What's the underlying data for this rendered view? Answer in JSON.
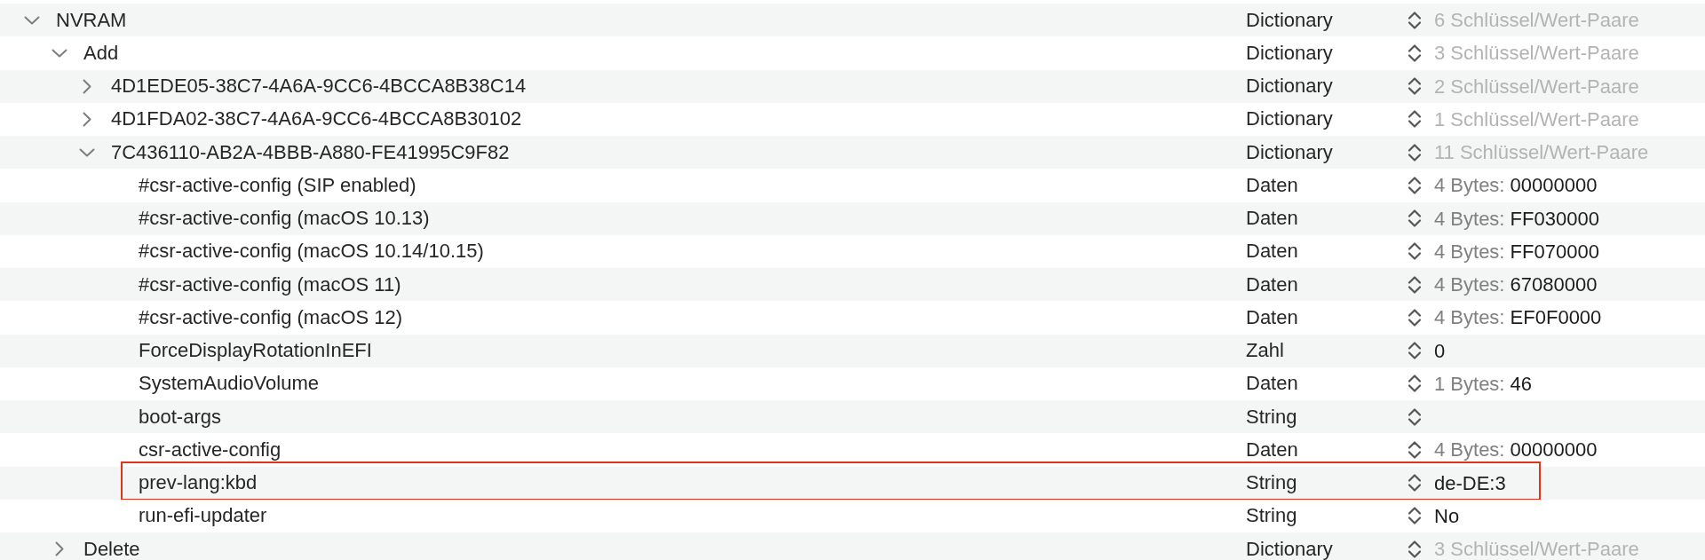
{
  "tree": [
    {
      "key": "NVRAM",
      "type": "Dictionary",
      "kind": "dictionary",
      "summary": "6 Schlüssel/Wert-Paare",
      "expanded": true,
      "children": [
        {
          "key": "Add",
          "type": "Dictionary",
          "kind": "dictionary",
          "summary": "3 Schlüssel/Wert-Paare",
          "expanded": true,
          "children": [
            {
              "key": "4D1EDE05-38C7-4A6A-9CC6-4BCCA8B38C14",
              "type": "Dictionary",
              "kind": "dictionary",
              "summary": "2 Schlüssel/Wert-Paare",
              "expanded": false
            },
            {
              "key": "4D1FDA02-38C7-4A6A-9CC6-4BCCA8B30102",
              "type": "Dictionary",
              "kind": "dictionary",
              "summary": "1 Schlüssel/Wert-Paare",
              "expanded": false
            },
            {
              "key": "7C436110-AB2A-4BBB-A880-FE41995C9F82",
              "type": "Dictionary",
              "kind": "dictionary",
              "summary": "11 Schlüssel/Wert-Paare",
              "expanded": true,
              "children": [
                {
                  "key": "#csr-active-config (SIP enabled)",
                  "type": "Daten",
                  "kind": "data",
                  "size": "4 Bytes:",
                  "value": "00000000",
                  "highlighted": false
                },
                {
                  "key": "#csr-active-config (macOS 10.13)",
                  "type": "Daten",
                  "kind": "data",
                  "size": "4 Bytes:",
                  "value": "FF030000",
                  "highlighted": false
                },
                {
                  "key": "#csr-active-config (macOS 10.14/10.15)",
                  "type": "Daten",
                  "kind": "data",
                  "size": "4 Bytes:",
                  "value": "FF070000",
                  "highlighted": false
                },
                {
                  "key": "#csr-active-config (macOS 11)",
                  "type": "Daten",
                  "kind": "data",
                  "size": "4 Bytes:",
                  "value": "67080000",
                  "highlighted": false
                },
                {
                  "key": "#csr-active-config (macOS 12)",
                  "type": "Daten",
                  "kind": "data",
                  "size": "4 Bytes:",
                  "value": "EF0F0000",
                  "highlighted": false
                },
                {
                  "key": "ForceDisplayRotationInEFI",
                  "type": "Zahl",
                  "kind": "number",
                  "value": "0",
                  "highlighted": false
                },
                {
                  "key": "SystemAudioVolume",
                  "type": "Daten",
                  "kind": "data",
                  "size": "1 Bytes:",
                  "value": "46",
                  "highlighted": false
                },
                {
                  "key": "boot-args",
                  "type": "String",
                  "kind": "string",
                  "highlighted": false
                },
                {
                  "key": "csr-active-config",
                  "type": "Daten",
                  "kind": "data",
                  "size": "4 Bytes:",
                  "value": "00000000",
                  "highlighted": false
                },
                {
                  "key": "prev-lang:kbd",
                  "type": "String",
                  "kind": "string",
                  "value": "de-DE:3",
                  "highlighted": true
                },
                {
                  "key": "run-efi-updater",
                  "type": "String",
                  "kind": "string",
                  "value": "No",
                  "highlighted": false
                }
              ]
            }
          ]
        },
        {
          "key": "Delete",
          "type": "Dictionary",
          "kind": "dictionary",
          "summary": "3 Schlüssel/Wert-Paare",
          "expanded": false
        }
      ]
    }
  ]
}
